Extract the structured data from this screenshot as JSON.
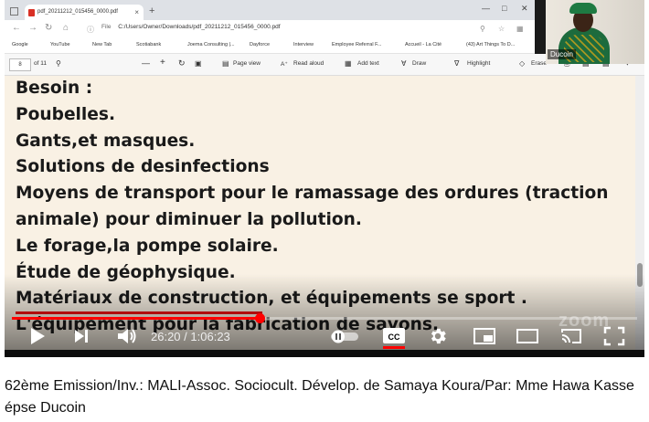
{
  "browser": {
    "tab_title": "pdf_20211212_015456_0000.pdf",
    "tab_close": "×",
    "new_tab": "+",
    "file_label": "File",
    "url": "C:/Users/Owner/Downloads/pdf_20211212_015456_0000.pdf",
    "bookmarks": [
      "Google",
      "YouTube",
      "New Tab",
      "Scotiabank",
      "Joema Consulting |...",
      "Dayforce",
      "Interview",
      "Employee Referral F...",
      "Accueil - La Cité",
      "(43) Art Things To D..."
    ]
  },
  "pdf_toolbar": {
    "page_number": "8",
    "page_total": "of 11",
    "page_view": "Page view",
    "read_aloud": "Read aloud",
    "add_text": "Add text",
    "draw": "Draw",
    "highlight": "Highlight",
    "erase": "Erase"
  },
  "webcam": {
    "name": "Ducoin"
  },
  "pdf_content": {
    "lines": [
      "Besoin :",
      "Poubelles.",
      "Gants,et masques.",
      "Solutions de desinfections",
      "Moyens de transport pour le ramassage des ordures (traction",
      "animale) pour diminuer la pollution.",
      "Le forage,la pompe solaire.",
      "Étude de géophysique.",
      "Matériaux de construction, et équipements se sport .",
      "L'équipement pour la fabrication de savons."
    ]
  },
  "player": {
    "current_time": "26:20",
    "duration": "1:06:23",
    "progress_fraction": 0.397,
    "watermark": "zoom",
    "cc_label": "CC",
    "accent": "#ff0000"
  },
  "video_caption": "62ème Emission/Inv.: MALI-Assoc. Sociocult. Dévelop. de Samaya Koura/Par: Mme Hawa Kasse épse Ducoin"
}
